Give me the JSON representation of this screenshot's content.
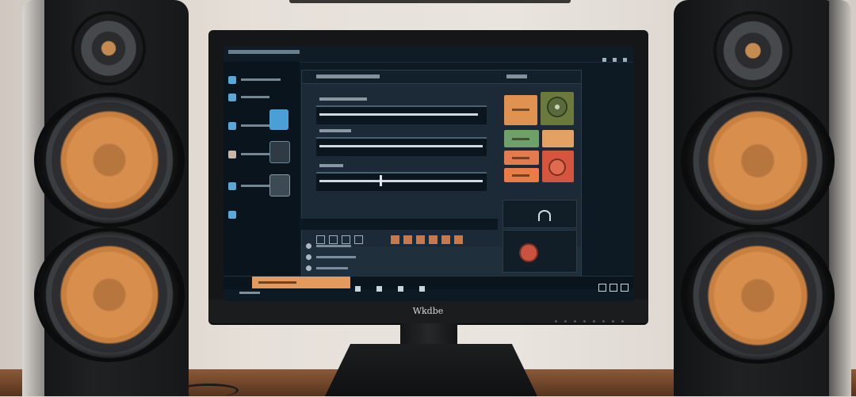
{
  "scene": {
    "monitor_brand": "Wkdbe",
    "speaker_cone_color": "#d88f4d",
    "accent_orange": "#e59a5c",
    "screen_bg": "#0d1a24"
  }
}
